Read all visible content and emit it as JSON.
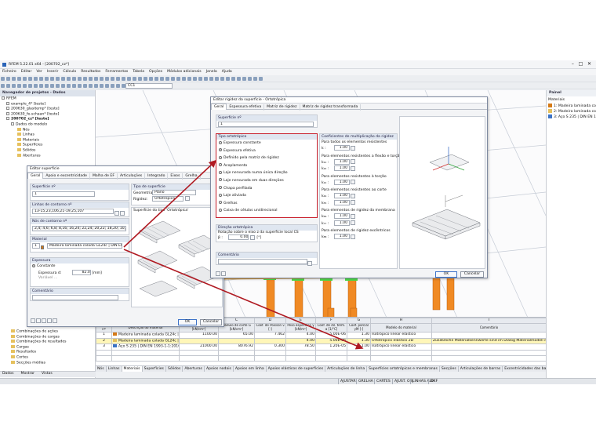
{
  "app": {
    "title": "RFEM 5.22.01 x64 - [200702_cz*]",
    "menu": [
      "Ficheiro",
      "Editar",
      "Ver",
      "Inserir",
      "Cálculo",
      "Resultados",
      "Ferramentas",
      "Tabela",
      "Opções",
      "Módulos adicionais",
      "Janela",
      "Ajuda"
    ],
    "toolbar_case": "CC1"
  },
  "navigator": {
    "title": "Navegador de projetos - Dados",
    "items": [
      "RFEM",
      "example_4* [teste]",
      "200630_glasitemp* [teste]",
      "200630_fe-schaan* [teste]",
      "200702_cz* [teste]",
      "Dados do modelo",
      "Nós",
      "Linhas",
      "Materiais",
      "Superfícies",
      "Sólidos",
      "Aberturas"
    ],
    "lower_items": [
      "Combinações de ações",
      "Combinações de cargas",
      "Combinações de resultados",
      "Cargas",
      "Resultados",
      "Cortes",
      "Secções médias"
    ],
    "tabs": [
      "Dados",
      "Mostrar",
      "Vistas"
    ]
  },
  "panel": {
    "title": "Painel",
    "section": "Materiais",
    "items": [
      {
        "label": "1: Madeira laminada cola",
        "color": "#d57a17"
      },
      {
        "label": "2: Madeira laminada cola",
        "color": "#e6c15e"
      },
      {
        "label": "3: Aço S 235 | DIN EN 19",
        "color": "#3d74c5"
      }
    ]
  },
  "dialog_surface": {
    "title": "Editar superfície",
    "tabs": [
      "Geral",
      "Apoio e excentricidade",
      "Malha de EF",
      "Articulações",
      "Integrado",
      "Eixos",
      "Grelha"
    ],
    "surface_no_label": "Superfície nº",
    "surface_no": "1",
    "boundary_lines_label": "Linhas de contorno nº",
    "boundary_lines": "13-15,23,106,21-19,25,107",
    "contour_lines_label": "Nós de contorno nº",
    "contour_lines": "2,4; 4,6; 6,8; 8,16; 16,24; 22,24; 20,22; 18,20; 10,18; 2,10",
    "material_label": "Material",
    "material_no": "1",
    "material_value": "Madeira laminada colada GL24c | DIN EN 14080:20",
    "thickness_label": "Espessura",
    "thickness_type": "Constante",
    "thickness_field_label": "Espessura d:",
    "thickness_value": "82.0",
    "thickness_unit": "[mm]",
    "variable_label": "Variável ...",
    "comment_label": "Comentário",
    "type_label": "Tipo de superfície",
    "geometry_label": "Geometria:",
    "geometry_value": "Plano",
    "stiffness_label": "Rigidez:",
    "stiffness_value": "Ortotrópica",
    "preview_label": "Superfície do tipo 'Ortotrópica'",
    "ok": "OK",
    "cancel": "Cancelar"
  },
  "dialog_stiffness": {
    "title": "Editar rigidez da superfície - Ortotrópica",
    "tabs": [
      "Geral",
      "Espessura efetiva",
      "Matriz de rigidez",
      "Matriz de rigidez transformada"
    ],
    "surface_no_label": "Superfície nº",
    "surface_no": "1",
    "ortho_type_label": "Tipo ortotrópico",
    "ortho_options": [
      "Espessura constante",
      "Espessura efetiva",
      "Definido pela matriz de rigidez",
      "Acoplamento",
      "Laje nervurada numa única direção",
      "Laje nervurada em duas direções",
      "Chapa perfilada",
      "Laje aliviada",
      "Grelhas",
      "Caixa de células unidirecional"
    ],
    "ortho_selected": 1,
    "direction_label": "Direção ortotrópica",
    "rotation_label": "Rotação sobre o eixo z da superfície local CS",
    "beta_symbol": "β :",
    "beta_value": "0.00",
    "beta_unit": "[°]",
    "comment_label": "Comentário",
    "coef_label": "Coeficientes de multiplicação da rigidez",
    "groups": [
      {
        "title": "Para todos os elementos resistentes",
        "rows": [
          {
            "sym": "k :",
            "val": "1.00"
          }
        ]
      },
      {
        "title": "Para elementos resistentes a flexão e torção",
        "rows": [
          {
            "sym": "k₁₁ :",
            "val": "1.00"
          },
          {
            "sym": "k₂₂ :",
            "val": "1.00"
          }
        ]
      },
      {
        "title": "Para elementos resistentes à torção",
        "rows": [
          {
            "sym": "k₁₂ :",
            "val": "1.00"
          }
        ]
      },
      {
        "title": "Para elementos resistentes ao corte",
        "rows": [
          {
            "sym": "k₄₄ :",
            "val": "1.00"
          },
          {
            "sym": "k₅₅ :",
            "val": "1.00"
          }
        ]
      },
      {
        "title": "Para elementos de rigidez da membrana",
        "rows": [
          {
            "sym": "k₆₆ :",
            "val": "1.00"
          },
          {
            "sym": "k₇₇ :",
            "val": "1.00"
          }
        ]
      },
      {
        "title": "Para elementos de rigidez excêntricos",
        "rows": [
          {
            "sym": "k₈₈ :",
            "val": "1.00"
          }
        ]
      }
    ],
    "ok": "OK",
    "cancel": "Cancelar"
  },
  "table": {
    "columns": [
      "Material nº",
      "Descrição do material",
      "Módulo de elasticida E [kN/cm²]",
      "Módulo de corte G [kN/cm²]",
      "Coef. de Poisson ν [-]",
      "Peso específico γ [kN/m³]",
      "Coef. de dil. térm. α [1/°C]",
      "Coef. parcial γM [-]",
      "Modelo do material",
      "Comentário"
    ],
    "col_letters": [
      "",
      "A",
      "B",
      "C",
      "D",
      "E",
      "F",
      "G",
      "H",
      "I"
    ],
    "rows": [
      [
        "1",
        "Madeira laminada colada GL24c | DIN EN",
        "1100.00",
        "65.00",
        "7.462",
        "4.00",
        "5.00E-06",
        "1.30",
        "Isotrópico linear elástico",
        ""
      ],
      [
        "2",
        "Madeira laminada colada GL24c | DIN EN",
        "",
        "",
        "",
        "4.00",
        "5.00E-06",
        "1.30",
        "Ortotrópico elástico 2D",
        "Zusätzliche Materialkennwerte sind im Dialog Materialmodell definiert"
      ],
      [
        "3",
        "Aço S 235 | DIN EN 1993-1-1:2010-12",
        "21000.00",
        "8076.92",
        "0.300",
        "78.50",
        "1.20E-05",
        "1.00",
        "Isotrópico linear elástico",
        ""
      ]
    ],
    "tabs": [
      "Nós",
      "Linhas",
      "Materiais",
      "Superfícies",
      "Sólidos",
      "Aberturas",
      "Apoios nodais",
      "Apoios em linha",
      "Apoios elásticos de superfícies",
      "Articulações de linha",
      "Superfícies ortotrópicas e membranas",
      "Secções",
      "Articulações de barras",
      "Excentricidades das barras",
      "Divisões de barras"
    ]
  },
  "statusbar": [
    "AJUSTAR",
    "GRELHA",
    "CARTES",
    "AJUST. OBJ",
    "LINHAS AUX",
    "DXF"
  ]
}
